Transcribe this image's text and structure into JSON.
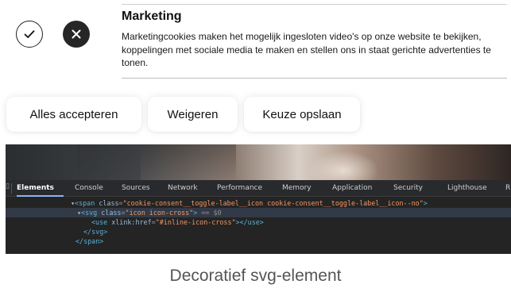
{
  "consent": {
    "category_title": "Marketing",
    "category_description": "Marketingcookies maken het mogelijk ingesloten video's op onze website te bekijken, koppelingen met sociale media te maken en stellen ons in staat gerichte advertenties te tonen.",
    "toggle_accept_icon": "check-icon",
    "toggle_reject_icon": "cross-icon"
  },
  "buttons": {
    "accept_all": "Alles accepteren",
    "decline": "Weigeren",
    "save_choice": "Keuze opslaan"
  },
  "devtools": {
    "tabs": [
      "Elements",
      "Console",
      "Sources",
      "Network",
      "Performance",
      "Memory",
      "Application",
      "Security",
      "Lighthouse",
      "R"
    ],
    "active_tab": "Elements",
    "code": {
      "line1_open": "<span",
      "line1_attr": "class",
      "line1_value": "\"cookie-consent__toggle-label__icon cookie-consent__toggle-label__icon--no\"",
      "line1_close": ">",
      "line2_open": "<svg",
      "line2_attr": "class",
      "line2_value": "\"icon icon-cross\"",
      "line2_close": ">",
      "line2_marker": "== $0",
      "line3_open": "<use",
      "line3_attr": "xlink:href",
      "line3_value": "\"#inline-icon-cross\"",
      "line3_close": "></use>",
      "line4": "</svg>",
      "line5": "</span>"
    }
  },
  "caption": "Decoratief svg-element",
  "colors": {
    "reject_toggle_bg": "#262626",
    "devtools_bg": "#242424",
    "active_tab_underline": "#8ab4f8",
    "tag_color": "#5db0d7",
    "value_color": "#f29766"
  }
}
